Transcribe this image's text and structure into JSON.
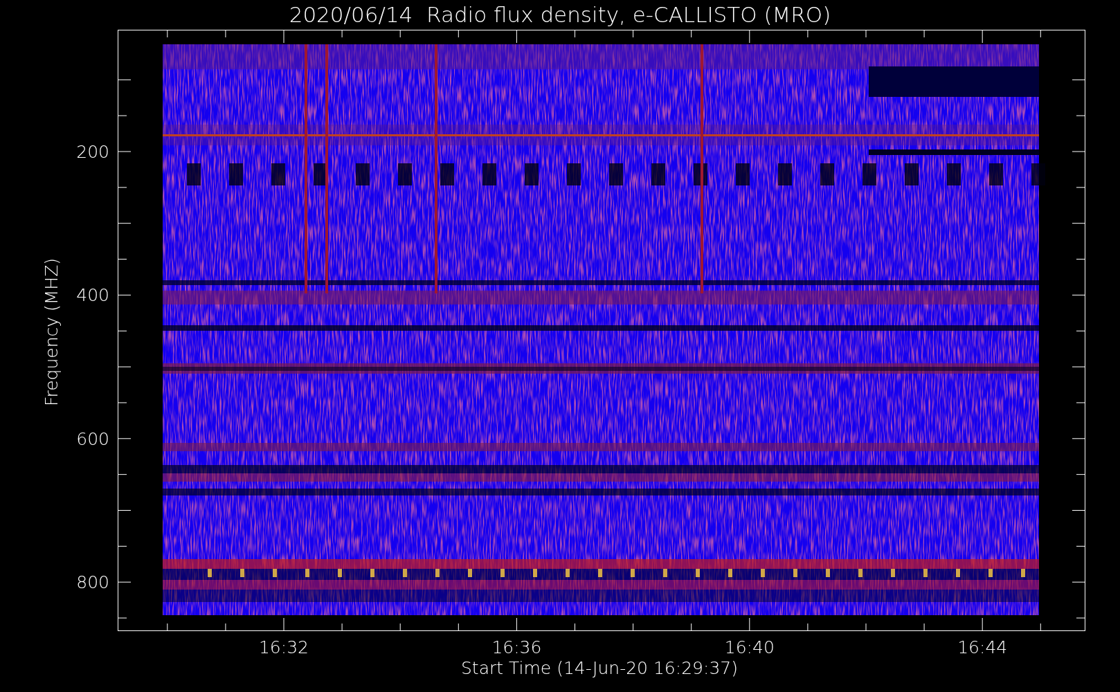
{
  "title": "2020/06/14  Radio flux density, e-CALLISTO (MRO)",
  "plot": {
    "ylabel": "Frequency (MHZ)",
    "xlabel": "Start Time (14-Jun-20 16:29:37)",
    "y_tick_labels": [
      "200",
      "400",
      "600",
      "800"
    ],
    "x_tick_labels": [
      "16:32",
      "16:36",
      "16:40",
      "16:44"
    ]
  }
}
